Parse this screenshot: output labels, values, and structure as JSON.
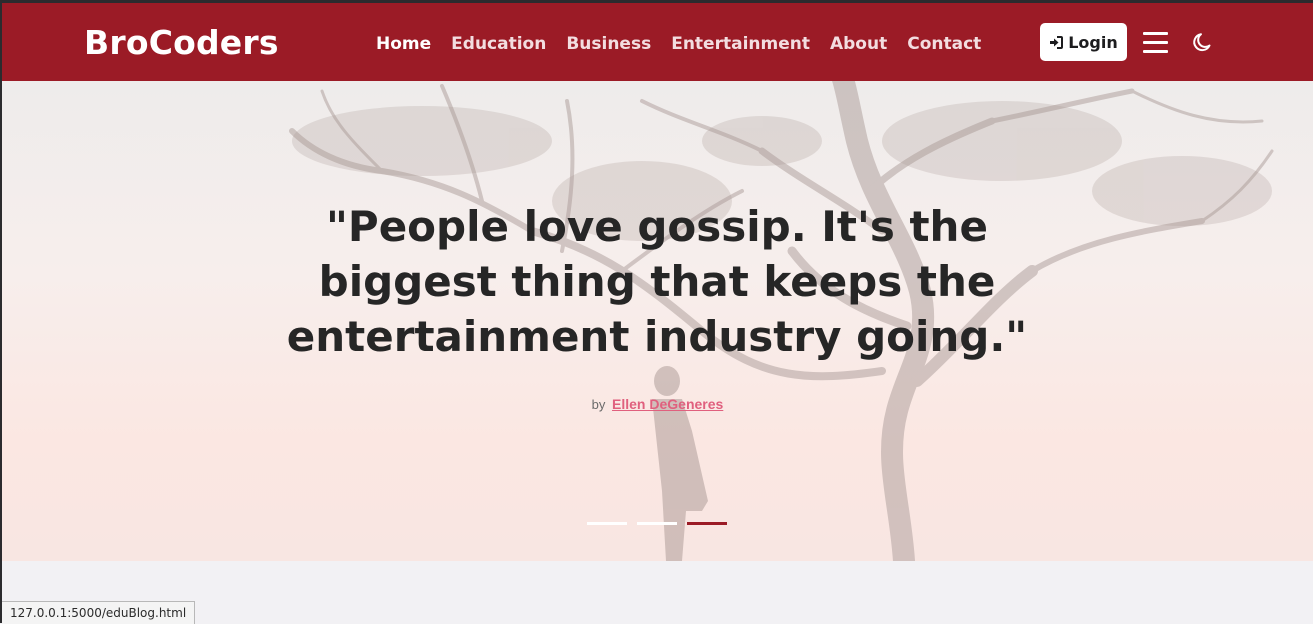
{
  "navbar": {
    "brand": "BroCoders",
    "links": [
      "Home",
      "Education",
      "Business",
      "Entertainment",
      "About",
      "Contact"
    ],
    "login_label": "Login",
    "menu_icon": "hamburger-icon",
    "theme_icon": "moon-icon",
    "background": "#9b1b26"
  },
  "hero": {
    "quote": "\"People love gossip. It's the biggest thing that keeps the entertainment industry going.\"",
    "by_label": "by",
    "author": "Ellen DeGeneres",
    "slide_count": 3,
    "active_slide": 3,
    "author_color": "#e0607e"
  },
  "status_bar": {
    "url": "127.0.0.1:5000/eduBlog.html"
  }
}
